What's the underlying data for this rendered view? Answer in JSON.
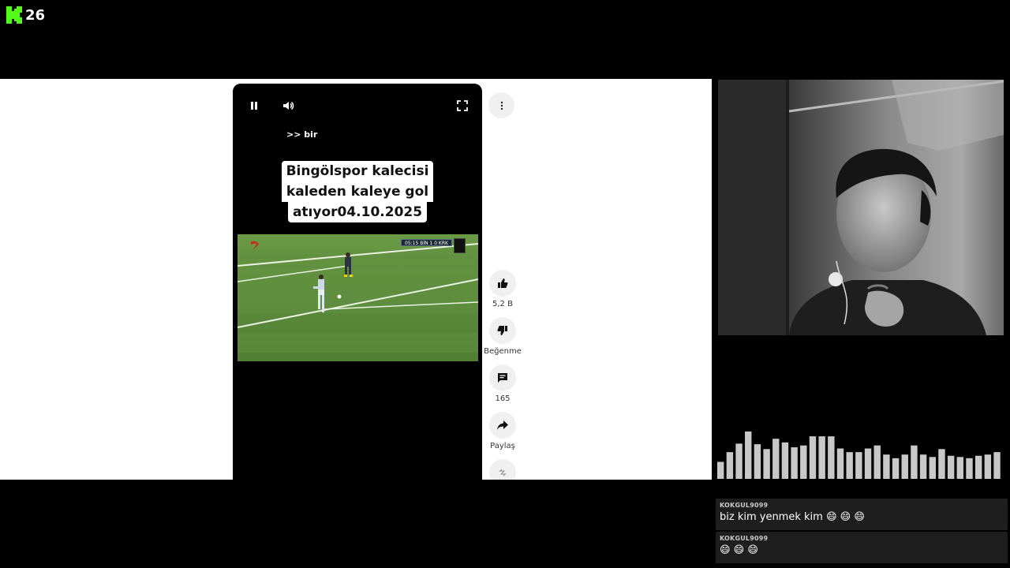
{
  "stream": {
    "viewer_count": "26",
    "brand_color": "#53fc18"
  },
  "short": {
    "channel_tag": ">> bir",
    "title_lines": [
      "Bingölspor kalecisi",
      "kaleden kaleye gol",
      "atıyor04.10.2025"
    ],
    "scoreboard": "05:15  BİN  1  0  KRK",
    "controls": {
      "pause_icon": "pause-icon",
      "volume_icon": "volume-icon",
      "fullscreen_icon": "fullscreen-icon",
      "more_icon": "more-vert-icon"
    }
  },
  "actions": {
    "like_count": "5,2 B",
    "dislike_label": "Beğenme",
    "comment_count": "165",
    "share_label": "Paylaş"
  },
  "chat": [
    {
      "user": "KOKGUL9099",
      "text": "biz kim yenmek kim 😄 😄 😄"
    },
    {
      "user": "KOKGUL9099",
      "text": "😄 😄 😄"
    }
  ],
  "visualizer_levels": [
    0.28,
    0.44,
    0.58,
    0.78,
    0.57,
    0.49,
    0.66,
    0.6,
    0.52,
    0.55,
    0.7,
    0.7,
    0.7,
    0.5,
    0.44,
    0.44,
    0.5,
    0.55,
    0.4,
    0.34,
    0.4,
    0.55,
    0.4,
    0.36,
    0.49,
    0.38,
    0.36,
    0.34,
    0.38,
    0.4,
    0.44
  ]
}
